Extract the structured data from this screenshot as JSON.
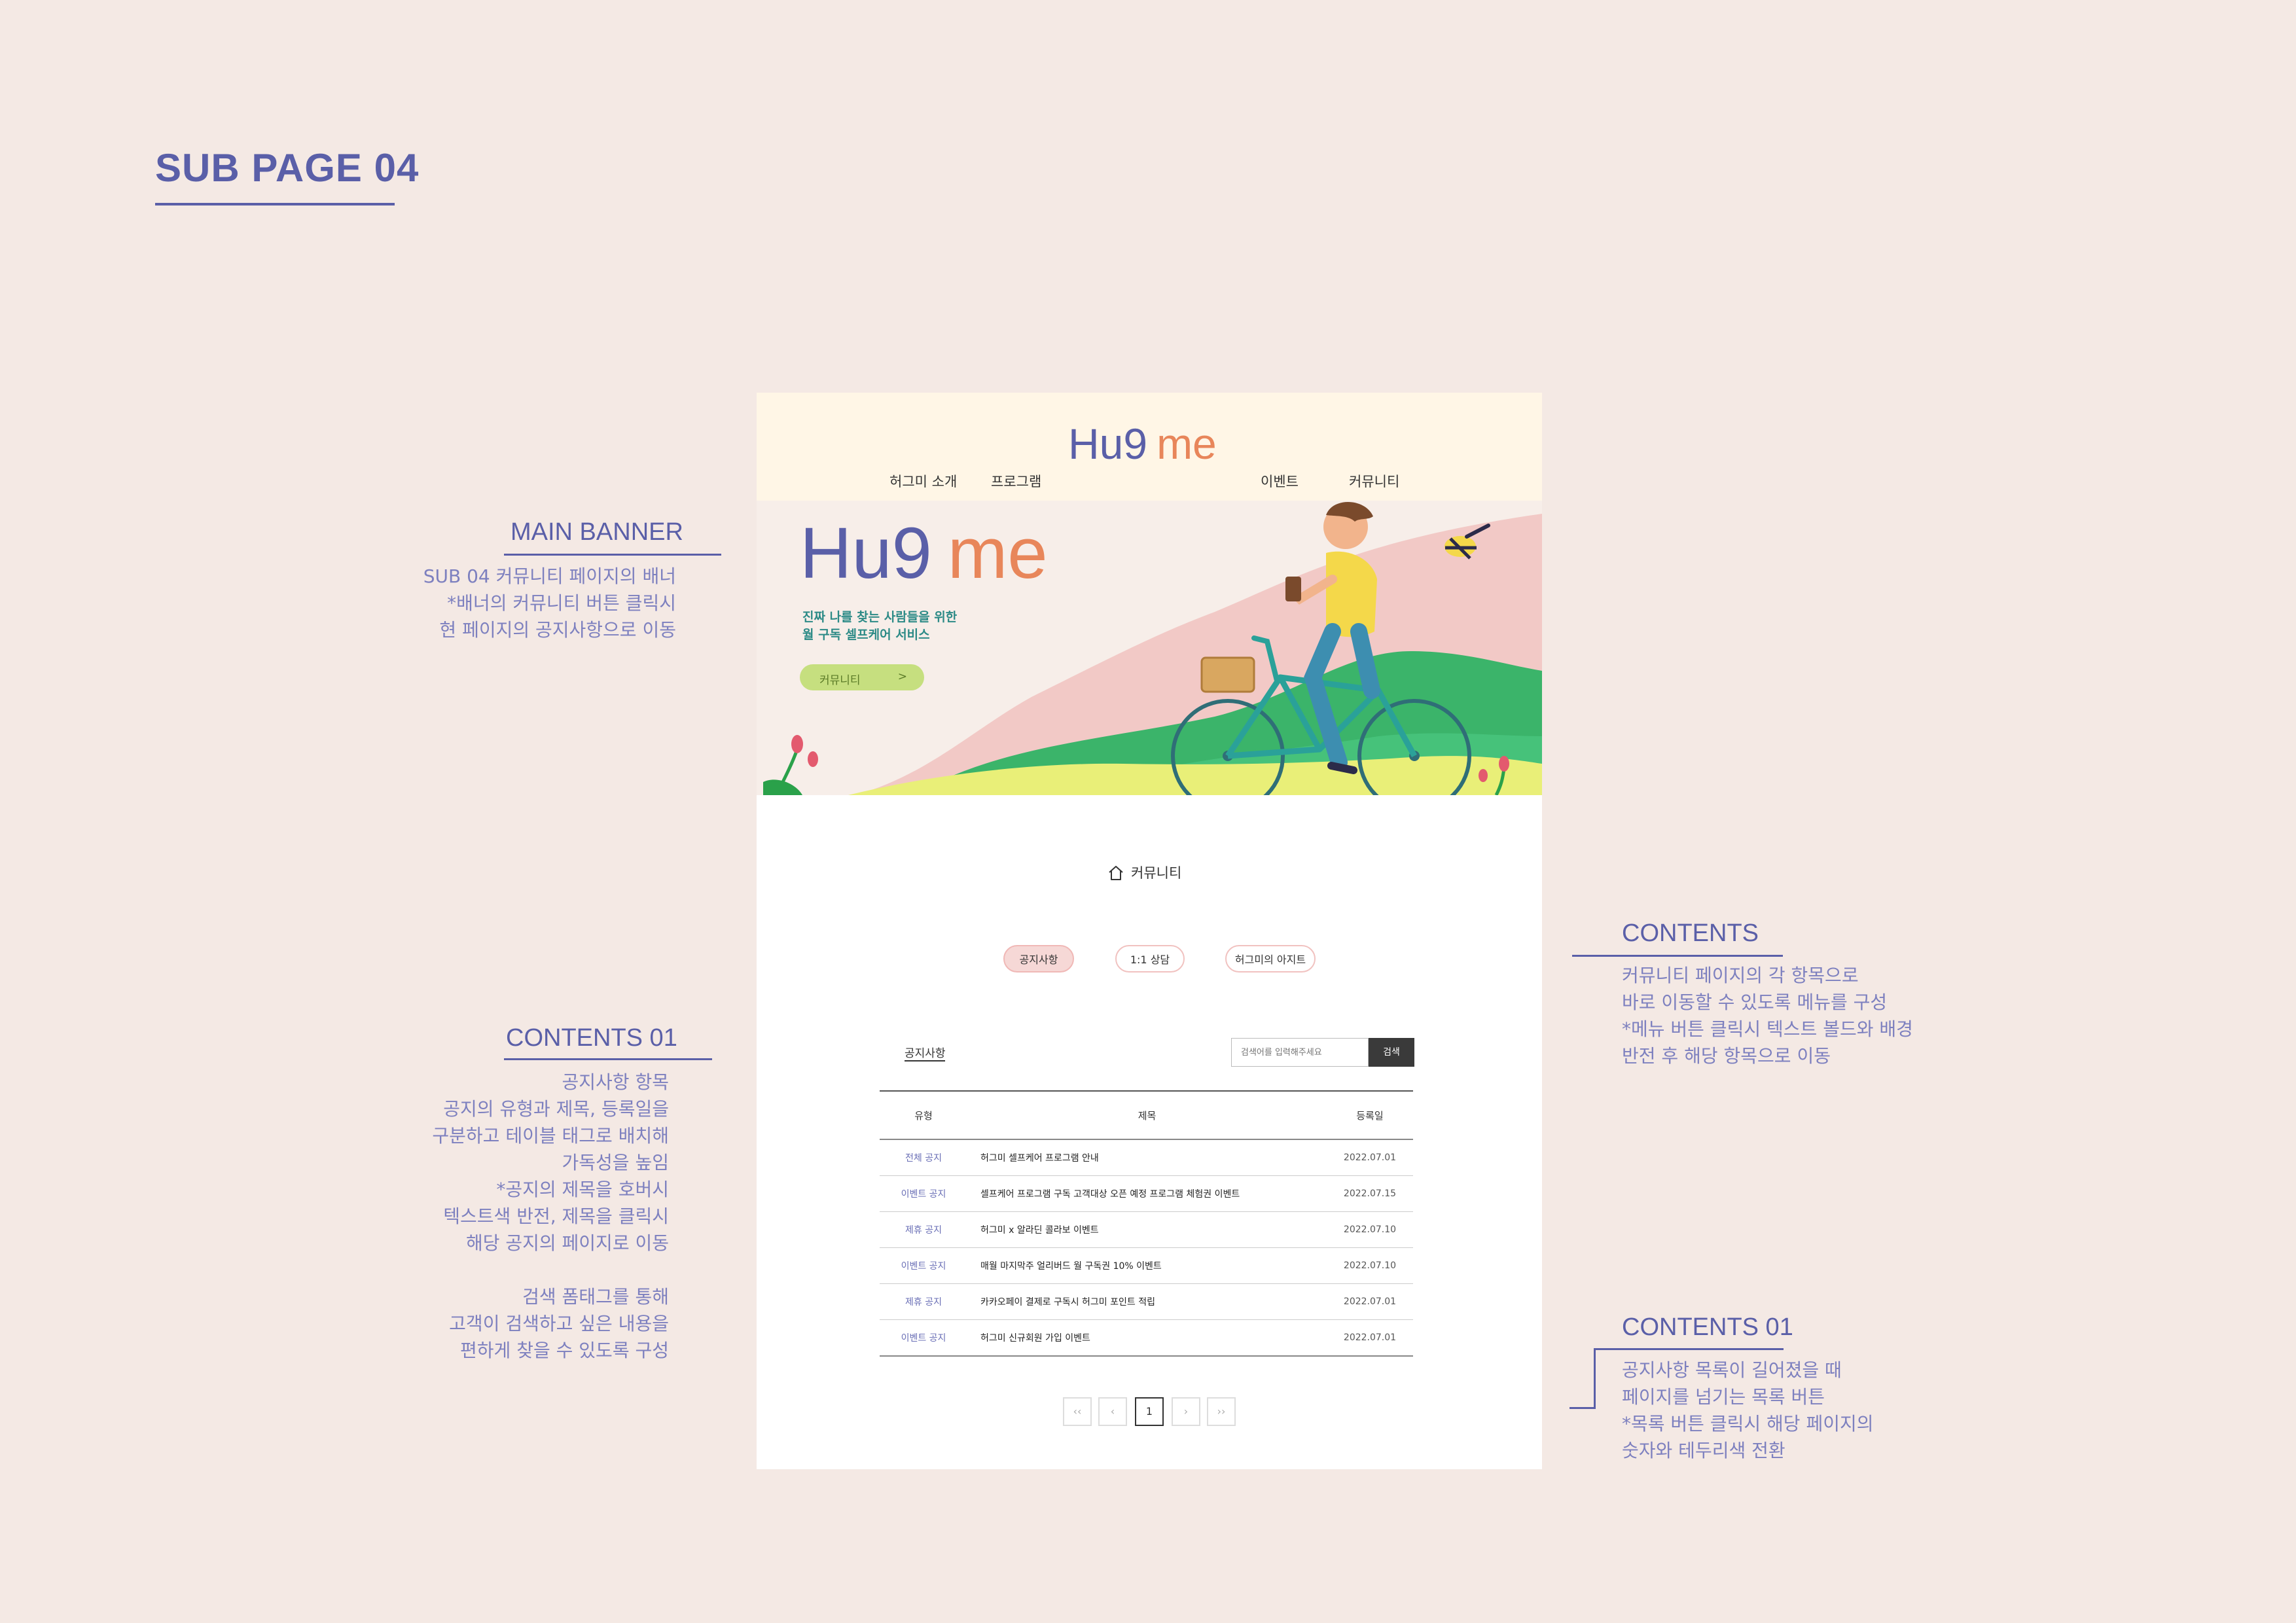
{
  "page": {
    "heading": "SUB PAGE 04"
  },
  "annotations": {
    "main_banner": {
      "title": "MAIN BANNER",
      "lines": [
        "SUB 04 커뮤니티 페이지의 배너",
        "*배너의 커뮤니티 버튼 클릭시",
        "현 페이지의 공지사항으로 이동"
      ]
    },
    "contents_left": {
      "title": "CONTENTS 01",
      "lines": [
        "공지사항 항목",
        "공지의 유형과 제목, 등록일을",
        "구분하고 테이블 태그로 배치해",
        "가독성을 높임",
        "*공지의 제목을 호버시",
        "텍스트색 반전, 제목을 클릭시",
        "해당 공지의 페이지로 이동",
        "",
        "검색 폼태그를 통해",
        "고객이 검색하고 싶은 내용을",
        "편하게 찾을 수 있도록 구성"
      ]
    },
    "contents_right": {
      "title": "CONTENTS",
      "lines": [
        "커뮤니티 페이지의 각 항목으로",
        "바로 이동할 수 있도록 메뉴를 구성",
        "*메뉴 버튼 클릭시 텍스트 볼드와 배경",
        "반전 후 해당 항목으로 이동"
      ]
    },
    "contents_pager": {
      "title": "CONTENTS 01",
      "lines": [
        "공지사항 목록이 길어졌을 때",
        "페이지를 넘기는 목록 버튼",
        "*목록 버튼 클릭시 해당 페이지의",
        "숫자와 테두리색 전환"
      ]
    }
  },
  "mockup": {
    "logo": {
      "part1": "Hu9",
      "part2": "me"
    },
    "nav": [
      "허그미 소개",
      "프로그램",
      "이벤트",
      "커뮤니티"
    ],
    "banner": {
      "logo_part1": "Hu9",
      "logo_part2": "me",
      "tagline": [
        "진짜 나를 찾는 사람들을 위한",
        "월 구독 셀프케어 서비스"
      ],
      "button_label": "커뮤니티",
      "button_arrow": ">"
    },
    "breadcrumb": "커뮤니티",
    "tabs": [
      "공지사항",
      "1:1 상담",
      "허그미의 아지트"
    ],
    "section_title": "공지사항",
    "search": {
      "placeholder": "검색어를 입력해주세요",
      "button": "검색"
    },
    "table": {
      "headers": [
        "유형",
        "제목",
        "등록일"
      ],
      "rows": [
        [
          "전체 공지",
          "허그미 셀프케어 프로그램 안내",
          "2022.07.01"
        ],
        [
          "이벤트 공지",
          "셀프케어 프로그램 구독 고객대상 오픈 예정 프로그램 체험권 이벤트",
          "2022.07.15"
        ],
        [
          "제휴 공지",
          "허그미 x 알라딘 콜라보 이벤트",
          "2022.07.10"
        ],
        [
          "이벤트 공지",
          "매월 마지막주 얼리버드 월 구독권 10% 이벤트",
          "2022.07.10"
        ],
        [
          "제휴 공지",
          "카카오페이 결제로 구독시 허그미 포인트 적립",
          "2022.07.01"
        ],
        [
          "이벤트 공지",
          "허그미 신규회원 가입 이벤트",
          "2022.07.01"
        ]
      ]
    },
    "pagination": [
      "‹‹",
      "‹",
      "1",
      "›",
      "››"
    ]
  },
  "colors": {
    "accent": "#5a5fa8",
    "logo_orange": "#e8865a",
    "page_background": "#f4e9e4",
    "header_background": "#fff6e6"
  }
}
